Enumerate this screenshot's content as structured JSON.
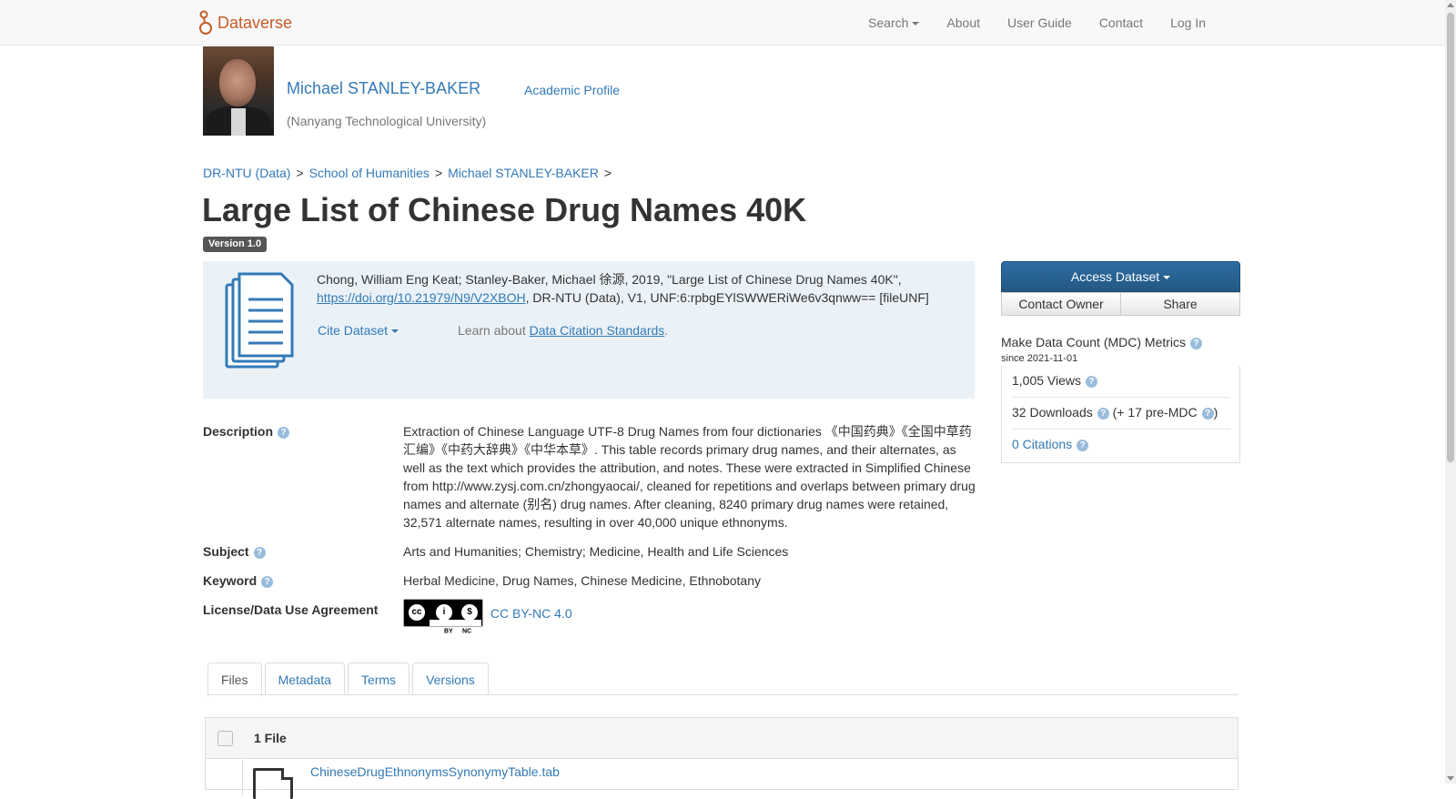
{
  "navbar": {
    "brand": "Dataverse",
    "links": [
      "Search",
      "About",
      "User Guide",
      "Contact",
      "Log In"
    ]
  },
  "dataverse": {
    "name": "Michael STANLEY-BAKER",
    "profile_link": "Academic Profile",
    "affiliation": "(Nanyang Technological University)"
  },
  "breadcrumb": [
    "DR-NTU (Data)",
    "School of Humanities",
    "Michael STANLEY-BAKER"
  ],
  "breadcrumb_sep": ">",
  "dataset": {
    "title": "Large List of Chinese Drug Names 40K",
    "version": "Version 1.0"
  },
  "citation": {
    "text_before": "Chong, William Eng Keat; Stanley-Baker, Michael 徐源, 2019, \"Large List of Chinese Drug Names 40K\", ",
    "doi": "https://doi.org/10.21979/N9/V2XBOH",
    "text_after": ", DR-NTU (Data), V1, UNF:6:rpbgEYlSWWERiWe6v3qnww== [fileUNF]",
    "cite_button": "Cite Dataset",
    "learn_prefix": "Learn about ",
    "learn_link": "Data Citation Standards",
    "learn_suffix": "."
  },
  "sidebar": {
    "access_button": "Access Dataset",
    "contact_button": "Contact Owner",
    "share_button": "Share",
    "mdc_title": "Make Data Count (MDC) Metrics",
    "mdc_since": "since 2021-11-01",
    "views": "1,005 Views",
    "downloads": "32 Downloads",
    "pre_mdc": "(+ 17 pre-MDC",
    "pre_mdc_close": ")",
    "citations": "0 Citations"
  },
  "metadata": {
    "description_label": "Description",
    "description": "Extraction of Chinese Language UTF-8 Drug Names from four dictionaries 《中国药典》《全国中草药汇编》《中药大辞典》《中华本草》. This table records primary drug names, and their alternates, as well as the text which provides the attribution, and notes. These were extracted in Simplified Chinese from http://www.zysj.com.cn/zhongyaocai/, cleaned for repetitions and overlaps between primary drug names and alternate (别名) drug names. After cleaning, 8240 primary drug names were retained, 32,571 alternate names, resulting in over 40,000 unique ethnonyms.",
    "subject_label": "Subject",
    "subject": "Arts and Humanities; Chemistry; Medicine, Health and Life Sciences",
    "keyword_label": "Keyword",
    "keyword": "Herbal Medicine, Drug Names, Chinese Medicine, Ethnobotany",
    "license_label": "License/Data Use Agreement",
    "license": "CC BY-NC 4.0",
    "license_badge": [
      "BY",
      "NC"
    ]
  },
  "tabs": [
    "Files",
    "Metadata",
    "Terms",
    "Versions"
  ],
  "files": {
    "count": "1 File",
    "rows": [
      {
        "name": "ChineseDrugEthnonymsSynonymyTable.tab"
      }
    ]
  },
  "colors": {
    "brand": "#c55b28",
    "link": "#337ab7",
    "primary_button": "#2d6ca2",
    "citation_bg": "#eaf2f8"
  },
  "icons": [
    "dataverse-logo-icon",
    "document-icon",
    "question-icon",
    "cc-license-icon",
    "file-icon"
  ]
}
